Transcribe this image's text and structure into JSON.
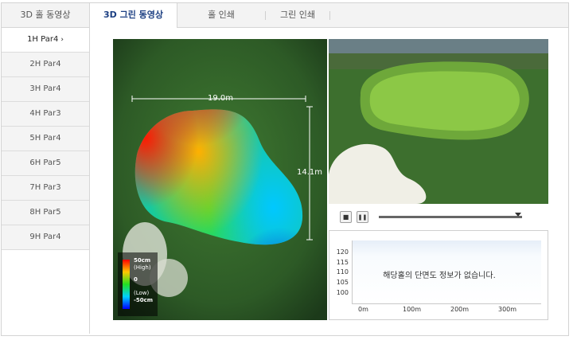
{
  "tabs": [
    {
      "label": "3D 홀 동영상",
      "active": false
    },
    {
      "label": "3D 그린 동영상",
      "active": true
    },
    {
      "label": "홀 인쇄",
      "active": false
    },
    {
      "label": "그린 인쇄",
      "active": false
    }
  ],
  "holes": [
    {
      "label": "1H Par4",
      "active": true,
      "chevron": "›"
    },
    {
      "label": "2H Par4",
      "active": false
    },
    {
      "label": "3H Par4",
      "active": false
    },
    {
      "label": "4H Par3",
      "active": false
    },
    {
      "label": "5H Par4",
      "active": false
    },
    {
      "label": "6H Par5",
      "active": false
    },
    {
      "label": "7H Par3",
      "active": false
    },
    {
      "label": "8H Par5",
      "active": false
    },
    {
      "label": "9H Par4",
      "active": false
    }
  ],
  "green_map": {
    "width_label": "19.0m",
    "depth_label": "14.1m",
    "legend": {
      "high_value": "50cm",
      "high_text": "(High)",
      "mid_value": "0",
      "low_text": "(Low)",
      "low_value": "-50cm"
    }
  },
  "player": {
    "stop_icon": "■",
    "pause_icon": "❚❚",
    "progress": 0.97
  },
  "profile": {
    "message": "해당홀의 단면도 정보가 없습니다.",
    "y_ticks": [
      "120",
      "115",
      "110",
      "105",
      "100"
    ],
    "x_ticks": [
      "0m",
      "100m",
      "200m",
      "300m"
    ]
  },
  "colors": {
    "active_tab_text": "#1c3f82",
    "legend_high": "#ff0000",
    "legend_low": "#0000ff"
  }
}
